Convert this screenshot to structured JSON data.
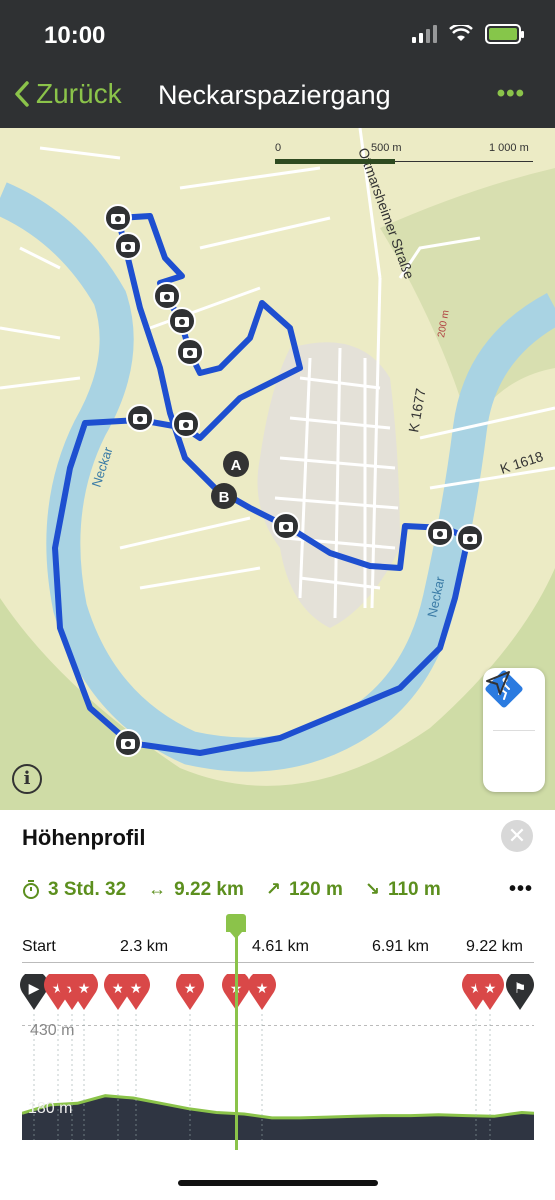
{
  "status": {
    "time": "10:00"
  },
  "nav": {
    "back_label": "Zurück",
    "title": "Neckarspaziergang",
    "more_label": "•••"
  },
  "map": {
    "scale_labels": [
      "0",
      "500 m",
      "1 000 m"
    ],
    "road_labels": [
      "Ottmarsheimer Straße",
      "K 1677",
      "K 1618"
    ],
    "river_labels": [
      "Neckar",
      "Neckar"
    ],
    "contour_label": "200 m",
    "waypoints": [
      "A",
      "B"
    ],
    "info_label": "i",
    "route_color": "#1e4fd0",
    "river_color": "#a9d3e3"
  },
  "panel": {
    "title": "Höhenprofil",
    "close_label": "✕",
    "stats": {
      "duration": "3 Std. 32",
      "distance": "9.22 km",
      "ascent": "120 m",
      "descent": "110 m",
      "more": "•••"
    },
    "axis_labels": [
      "Start",
      "2.3 km",
      "4.61 km",
      "6.91 km",
      "9.22 km"
    ],
    "elev_labels": [
      "430 m",
      "180 m"
    ]
  },
  "chart_data": {
    "type": "area",
    "x": [
      0,
      0.5,
      1.0,
      1.5,
      2.0,
      2.5,
      3.0,
      3.5,
      4.0,
      4.5,
      5.0,
      5.5,
      6.0,
      6.5,
      7.0,
      7.5,
      8.0,
      8.5,
      9.0,
      9.22
    ],
    "values": [
      200,
      222,
      226,
      246,
      240,
      226,
      212,
      202,
      198,
      188,
      188,
      190,
      192,
      194,
      194,
      196,
      194,
      192,
      202,
      200
    ],
    "xlabel": "",
    "ylabel": "",
    "x_ticks": [
      "Start",
      "2.3 km",
      "4.61 km",
      "6.91 km",
      "9.22 km"
    ],
    "y_ticks": [
      "430 m",
      "180 m"
    ],
    "xlim": [
      0,
      9.22
    ],
    "ylim": [
      130,
      460
    ],
    "grid": true,
    "fill_color": "#2f3542",
    "line_color": "#8bc34a"
  }
}
